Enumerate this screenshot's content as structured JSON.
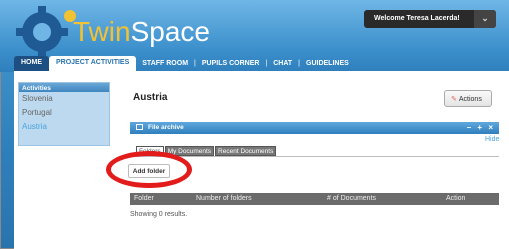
{
  "brand": {
    "name_part1": "Twin",
    "name_part2": "Space"
  },
  "user": {
    "welcome": "Welcome Teresa Lacerda!",
    "menu_arrow": "chevron-down-icon"
  },
  "nav": {
    "home": "HOME",
    "project_activities": "PROJECT ACTIVITIES",
    "staff_room": "STAFF ROOM",
    "pupils_corner": "PUPILS CORNER",
    "chat": "CHAT",
    "guidelines": "GUIDELINES",
    "separator": "|"
  },
  "sidebar": {
    "title": "Activities",
    "items": [
      {
        "label": "Slovenia"
      },
      {
        "label": "Portugal"
      },
      {
        "label": "Austria"
      }
    ]
  },
  "main": {
    "title": "Austria",
    "actions_label": "Actions",
    "archive": {
      "title": "File archive",
      "controls": "– + ×",
      "hide": "Hide",
      "tabs": [
        "Folders",
        "My Documents",
        "Recent Documents"
      ],
      "add_folder": "Add folder",
      "columns": [
        "Folder",
        "Number of folders",
        "# of Documents",
        "Action"
      ],
      "status": "Showing 0 results."
    }
  },
  "colors": {
    "accent": "#2f7fbd",
    "highlight_circle": "#e21b1b"
  }
}
